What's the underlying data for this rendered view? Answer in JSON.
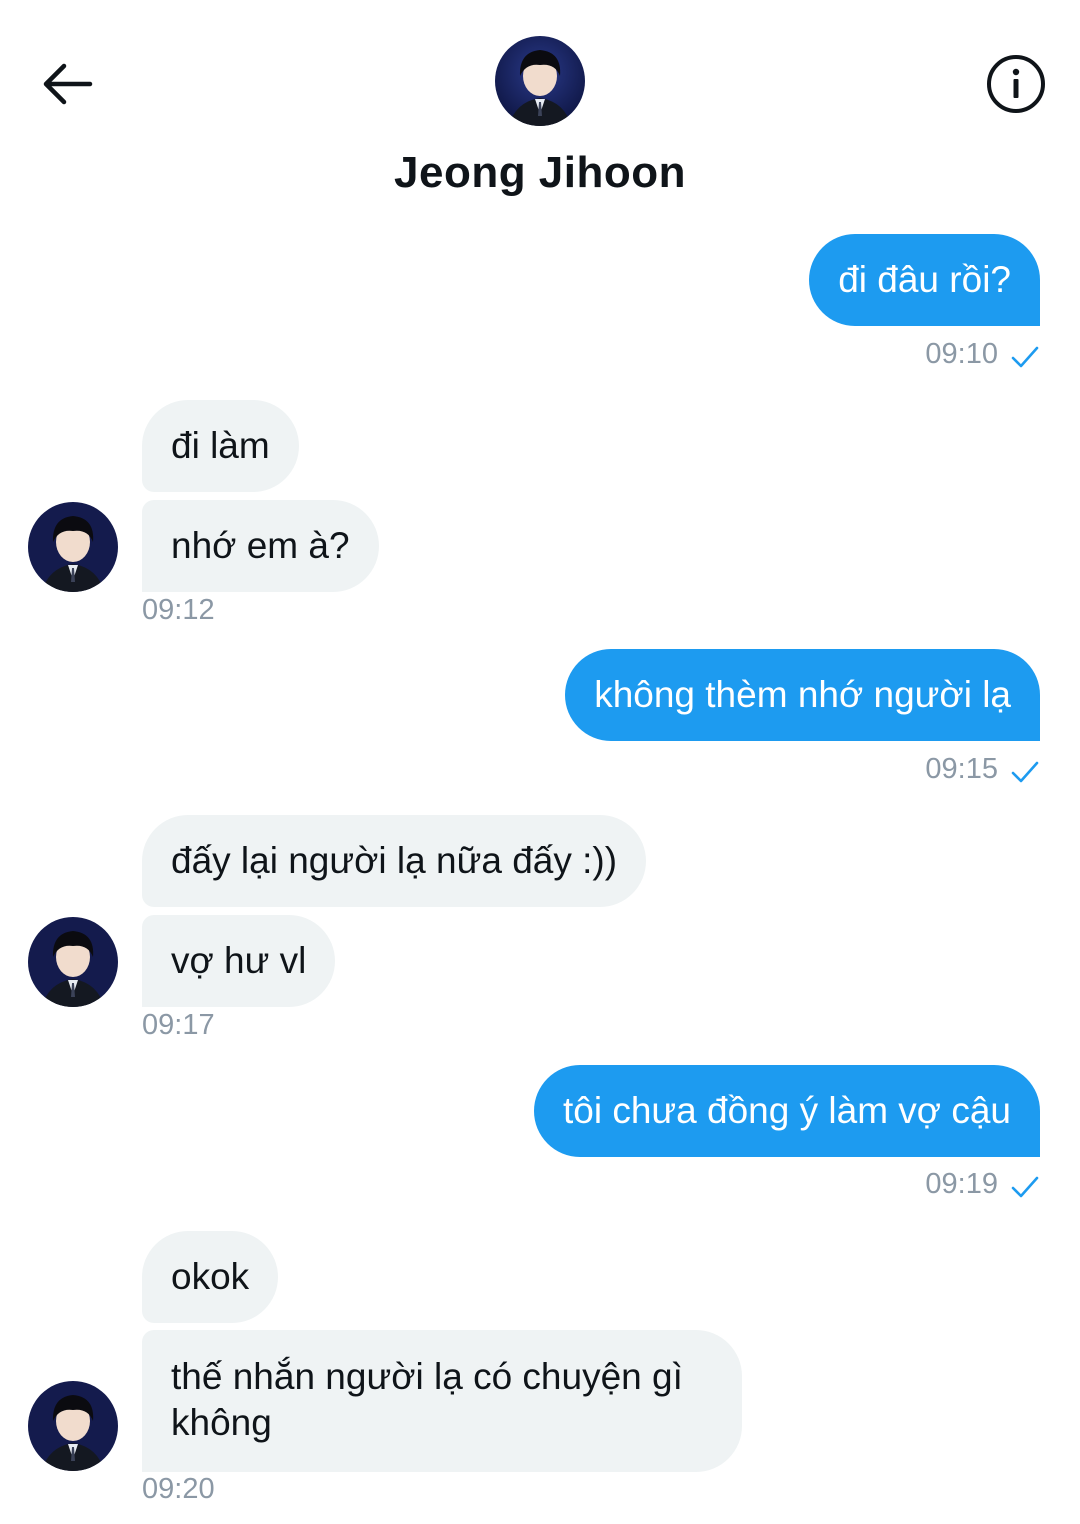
{
  "header": {
    "contact_name": "Jeong Jihoon",
    "back_icon": "arrow-left-icon",
    "info_icon": "info-icon"
  },
  "messages": [
    {
      "direction": "out",
      "text": "đi đâu rồi?",
      "time": "09:10",
      "status": "sent-check"
    },
    {
      "direction": "in",
      "text": "đi làm"
    },
    {
      "direction": "in",
      "text": "nhớ em à?",
      "time": "09:12"
    },
    {
      "direction": "out",
      "text": "không thèm nhớ người lạ",
      "time": "09:15",
      "status": "sent-check"
    },
    {
      "direction": "in",
      "text": "đấy lại người lạ nữa đấy :))"
    },
    {
      "direction": "in",
      "text": "vợ hư vl",
      "time": "09:17"
    },
    {
      "direction": "out",
      "text": "tôi chưa đồng ý làm vợ cậu",
      "time": "09:19",
      "status": "sent-check"
    },
    {
      "direction": "in",
      "text": "okok"
    },
    {
      "direction": "in",
      "text": "thế nhắn người lạ có chuyện gì không",
      "time": "09:20"
    }
  ],
  "colors": {
    "outgoing_bubble": "#1d9bf0",
    "incoming_bubble": "#eff3f4",
    "timestamp": "#8b98a5",
    "check": "#1d9bf0"
  }
}
